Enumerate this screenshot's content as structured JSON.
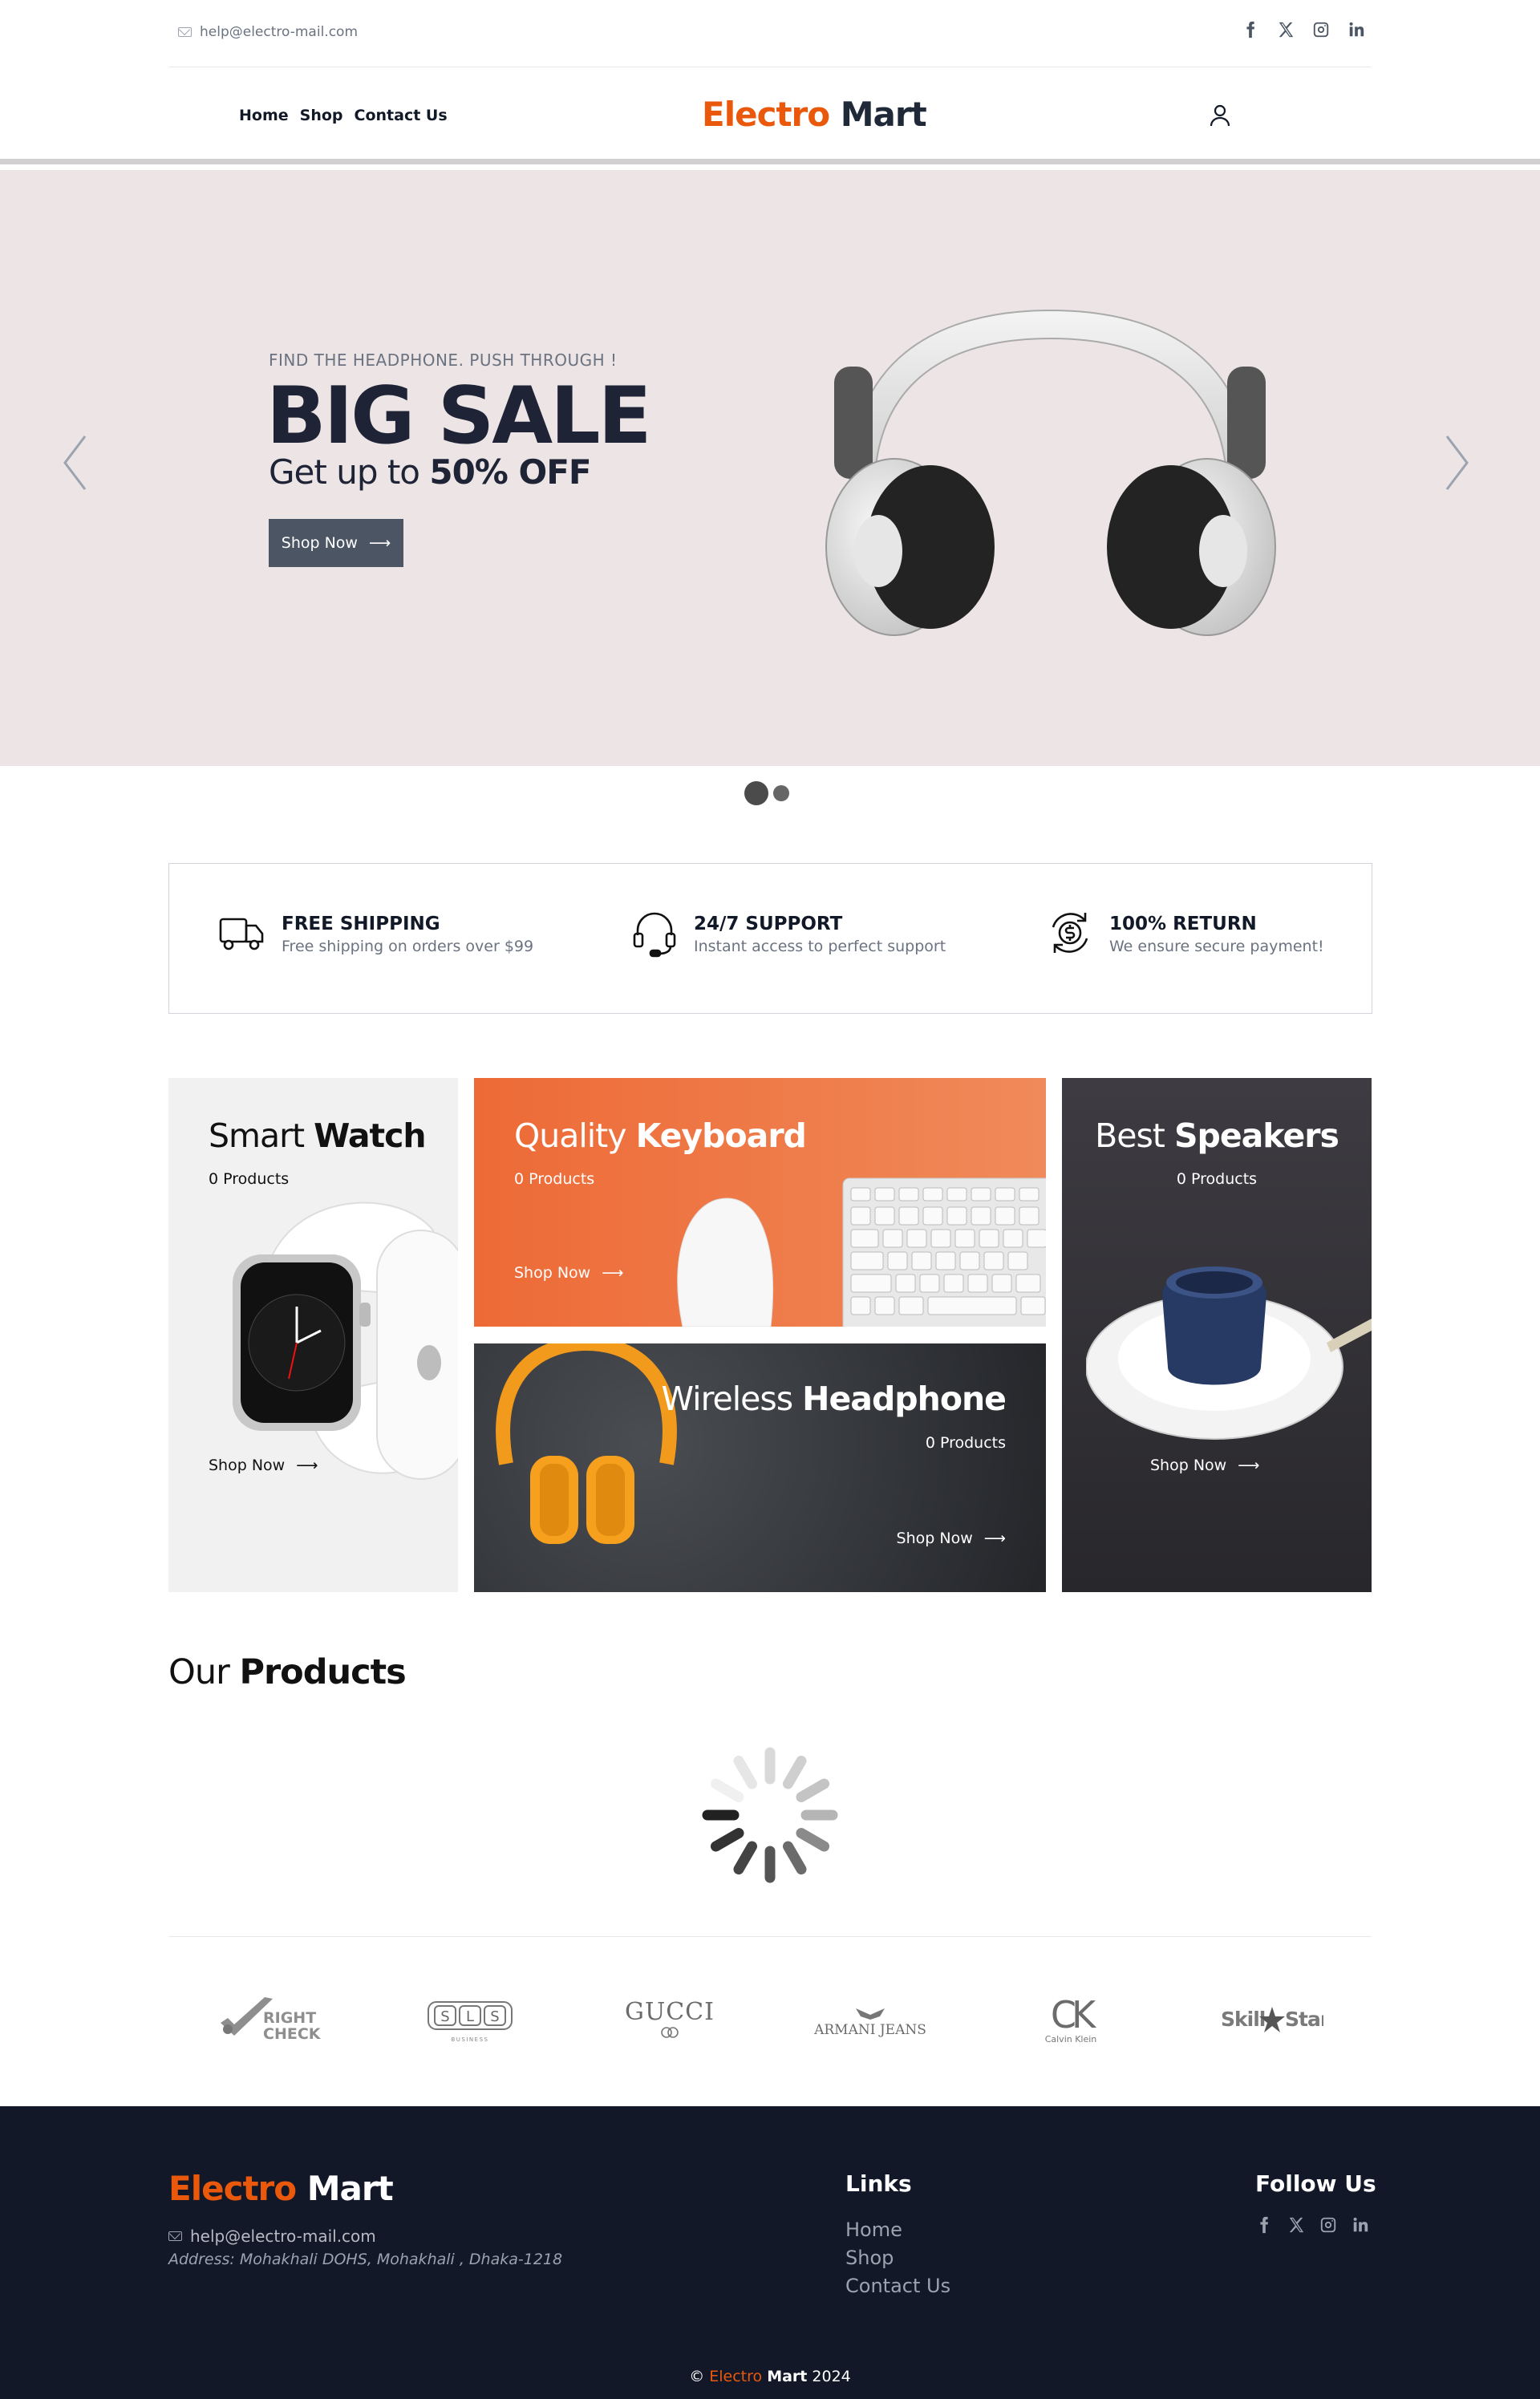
{
  "topbar": {
    "email": "help@electro-mail.com",
    "social_icons": [
      "facebook-icon",
      "x-icon",
      "instagram-icon",
      "linkedin-icon"
    ]
  },
  "nav": {
    "links": [
      "Home",
      "Shop",
      "Contact Us"
    ],
    "logo_part1": "Electro",
    "logo_part2": "Mart"
  },
  "hero": {
    "tagline": "FIND THE HEADPHONE. PUSH THROUGH !",
    "title": "BIG SALE",
    "subtitle_prefix": "Get up to",
    "subtitle_bold": "50% OFF",
    "button": "Shop Now",
    "slide_count": 2,
    "active_slide": 1
  },
  "features": [
    {
      "icon": "truck-icon",
      "title": "FREE SHIPPING",
      "desc": "Free shipping on orders over $99"
    },
    {
      "icon": "headset-icon",
      "title": "24/7 SUPPORT",
      "desc": "Instant access to perfect support"
    },
    {
      "icon": "dollar-return-icon",
      "title": "100% RETURN",
      "desc": "We ensure secure payment!"
    }
  ],
  "categories": [
    {
      "light": "Smart",
      "bold": "Watch",
      "count": "0 Products",
      "cta": "Shop Now"
    },
    {
      "light": "Quality",
      "bold": "Keyboard",
      "count": "0 Products",
      "cta": "Shop Now"
    },
    {
      "light": "Wireless",
      "bold": "Headphone",
      "count": "0 Products",
      "cta": "Shop Now"
    },
    {
      "light": "Best",
      "bold": "Speakers",
      "count": "0 Products",
      "cta": "Shop Now"
    }
  ],
  "products": {
    "heading_light": "Our",
    "heading_bold": "Products"
  },
  "brands": {
    "right_check_1": "RIGHT",
    "right_check_2": "CHECK",
    "sls_letters": [
      "S",
      "L",
      "S"
    ],
    "sls_sub": "BUSINESS",
    "gucci": "GUCCI",
    "armani": "ARMANI JEANS",
    "ck": "CK",
    "ck_sub": "Calvin Klein",
    "skillstar_1": "Skill",
    "skillstar_2": "Star"
  },
  "footer": {
    "logo_part1": "Electro",
    "logo_part2": "Mart",
    "email": "help@electro-mail.com",
    "address": "Address: Mohakhali DOHS, Mohakhali , Dhaka-1218",
    "links_heading": "Links",
    "links": [
      "Home",
      "Shop",
      "Contact Us"
    ],
    "follow_heading": "Follow Us",
    "copyright_symbol": "©",
    "copyright_brand1": "Electro",
    "copyright_brand2": "Mart",
    "copyright_year": "2024"
  },
  "colors": {
    "accent": "#ea580c",
    "hero_bg": "#ece4e5",
    "footer_bg": "#121828",
    "button": "#4b5563"
  }
}
